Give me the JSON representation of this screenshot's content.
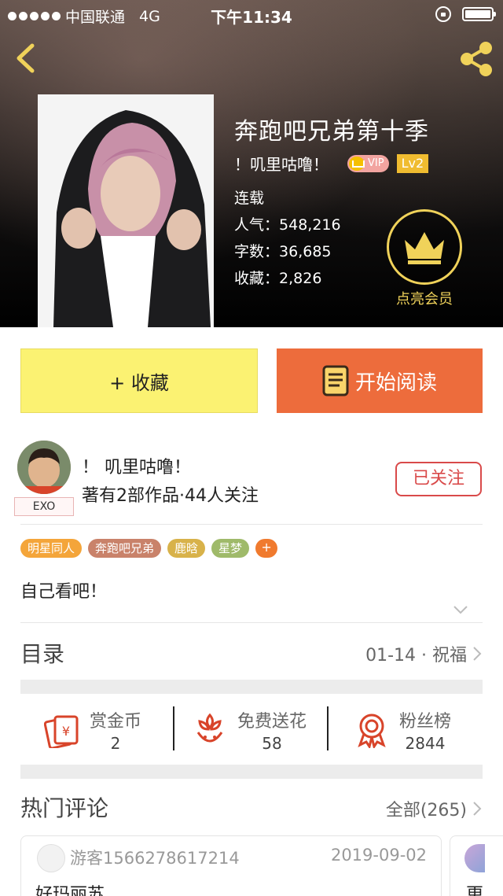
{
  "status_bar": {
    "carrier": "中国联通",
    "network": "4G",
    "time": "下午11:34"
  },
  "book": {
    "title": "奔跑吧兄弟第十季",
    "author": "！叽里咕噜！",
    "vip_label": "VIP",
    "level": "Lv2",
    "status": "连载",
    "popularity_label": "人气：",
    "popularity": "548,216",
    "words_label": "字数：",
    "words": "36,685",
    "favorites_label": "收藏：",
    "favorites": "2,826"
  },
  "member": {
    "label": "点亮会员"
  },
  "actions": {
    "favorite_label": "+ 收藏",
    "read_label": "开始阅读"
  },
  "author_panel": {
    "name": "！ 叽里咕噜！",
    "stats": "著有2部作品·44人关注",
    "badge": "EXO",
    "follow_label": "已关注"
  },
  "tags": [
    {
      "label": "明星同人",
      "color": "#f4a53a"
    },
    {
      "label": "奔跑吧兄弟",
      "color": "#c9826a"
    },
    {
      "label": "鹿晗",
      "color": "#d8b24a"
    },
    {
      "label": "星梦",
      "color": "#9fba6a"
    }
  ],
  "tag_more": "+",
  "description": "自己看吧！",
  "catalogue": {
    "title": "目录",
    "latest": "01-14 · 祝福"
  },
  "stats": [
    {
      "label": "赏金币",
      "value": "2",
      "icon": "red-envelope-icon"
    },
    {
      "label": "免费送花",
      "value": "58",
      "icon": "flower-icon"
    },
    {
      "label": "粉丝榜",
      "value": "2844",
      "icon": "ribbon-medal-icon"
    }
  ],
  "comments": {
    "title": "热门评论",
    "all_label": "全部(265)",
    "items": [
      {
        "user": "游客1566278617214",
        "date": "2019-09-02",
        "text": "好玛丽苏"
      },
      {
        "text": "更"
      }
    ]
  },
  "colors": {
    "accent_orange": "#ed6c3c",
    "favorite_yellow": "#fbf272",
    "follow_red": "#d94a4a",
    "gold": "#f0d25a"
  }
}
